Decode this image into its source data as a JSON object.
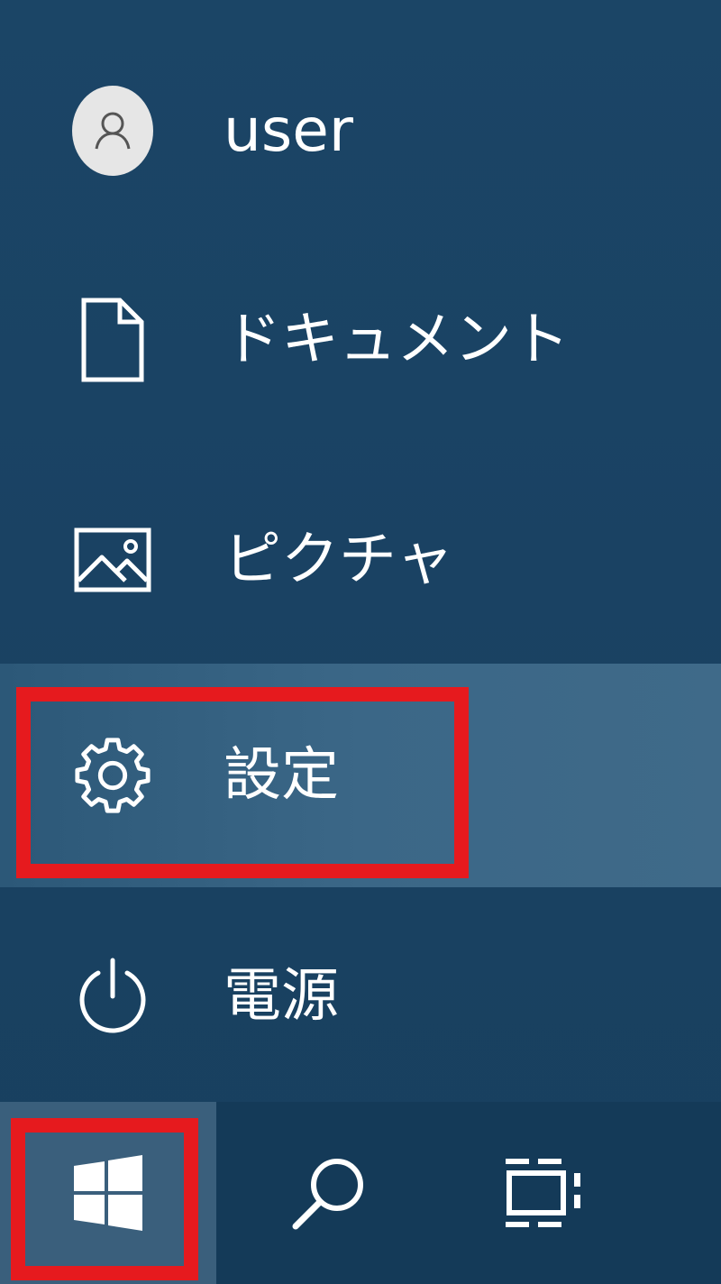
{
  "start_menu": {
    "items": [
      {
        "id": "user",
        "label": "user",
        "icon": "user-avatar-icon"
      },
      {
        "id": "documents",
        "label": "ドキュメント",
        "icon": "document-icon"
      },
      {
        "id": "pictures",
        "label": "ピクチャ",
        "icon": "picture-icon"
      },
      {
        "id": "settings",
        "label": "設定",
        "icon": "gear-icon",
        "state": "hovered"
      },
      {
        "id": "power",
        "label": "電源",
        "icon": "power-icon"
      }
    ]
  },
  "taskbar": {
    "items": [
      {
        "id": "start",
        "icon": "windows-logo-icon",
        "state": "active"
      },
      {
        "id": "search",
        "icon": "search-icon"
      },
      {
        "id": "task-view",
        "icon": "task-view-icon"
      }
    ]
  },
  "annotations": {
    "highlight_color": "#e61a1e",
    "highlighted_targets": [
      "settings",
      "start"
    ]
  },
  "colors": {
    "menu_background": "#1b4566",
    "hover_background": "#3b6787",
    "taskbar_background": "#143a58",
    "start_active_background": "#3a5f7c",
    "text": "#ffffff"
  }
}
